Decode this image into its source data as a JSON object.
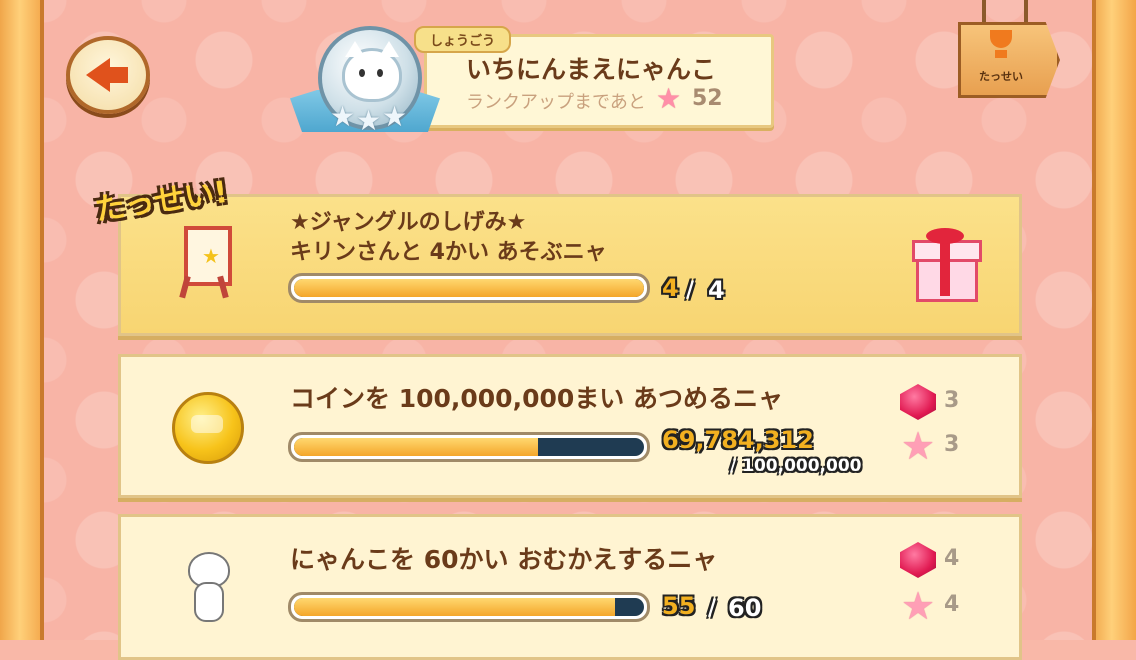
{
  "header": {
    "title_tag": "しょうごう",
    "title_name": "いちにんまえにゃんこ",
    "rank_up_text": "ランクアップまであと",
    "rank_up_remaining": "52",
    "achievements_label": "たっせい"
  },
  "missions": [
    {
      "completed": true,
      "done_label": "たっせい!",
      "line1": "★ジャングルのしげみ★",
      "line2": "キリンさんと 4かい あそぶニャ",
      "progress": 1.0,
      "current": "4",
      "separator": "/",
      "goal": "4",
      "icon": "easel-star-icon",
      "reward_icon": "gift-icon"
    },
    {
      "completed": false,
      "line1": "コインを 100,000,000まい あつめるニャ",
      "progress": 0.698,
      "current": "69,784,312",
      "goal_text": "/ 100,000,000",
      "icon": "gold-coin-icon",
      "reward_gems": "3",
      "reward_stars": "3"
    },
    {
      "completed": false,
      "line1": "にゃんこを 60かい おむかえするニャ",
      "progress": 0.917,
      "current": "55",
      "separator": "/",
      "goal": "60",
      "icon": "white-cat-icon",
      "reward_gems": "4",
      "reward_stars": "4"
    }
  ],
  "colors": {
    "background": "#f8b4a6",
    "bar_fill": "#f4a62a",
    "bar_empty": "#1f3b52",
    "text_brown": "#6a3b1a",
    "count_yellow": "#f2b020"
  }
}
